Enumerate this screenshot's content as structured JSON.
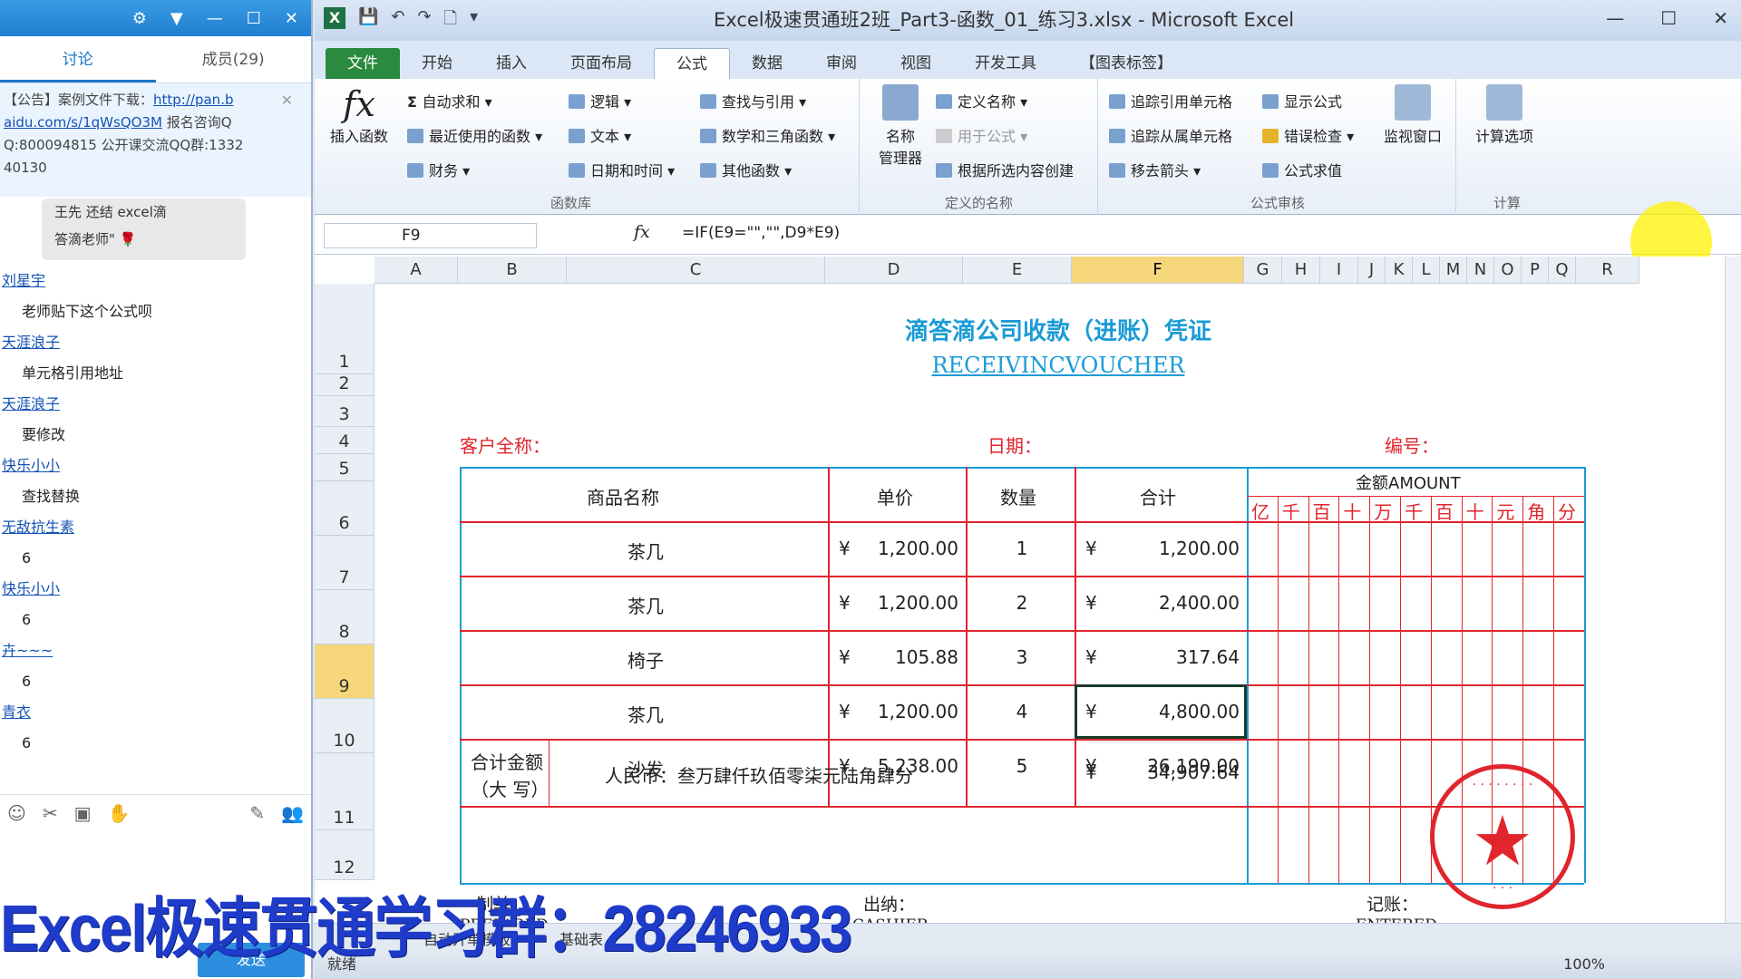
{
  "chat": {
    "tabs": [
      "讨论",
      "成员(29)"
    ],
    "notice_prefix": "【公告】案例文件下载：",
    "notice_link1": "http://pan.b",
    "notice_link2": "aidu.com/s/1qWsQO3M",
    "notice_rest1": " 报名咨询Q",
    "notice_line3": "Q:800094815  公开课交流QQ群:1332",
    "notice_line4": "40130",
    "quote_line1": "王先  还结  excel滴",
    "quote_line2": "答滴老师\"",
    "messages": [
      {
        "user": "刘星宇",
        "text": "老师贴下这个公式呗"
      },
      {
        "user": "天涯浪子",
        "text": "单元格引用地址"
      },
      {
        "user": "天涯浪子",
        "text": "要修改"
      },
      {
        "user": "快乐小小",
        "text": "查找替换"
      },
      {
        "user": "无敌抗生素",
        "text": "6"
      },
      {
        "user": "快乐小小",
        "text": "6"
      },
      {
        "user": "卉~~~",
        "text": "6"
      },
      {
        "user": "青衣",
        "text": "6"
      }
    ],
    "send_label": "发送",
    "watermark": "Excel极速贯通学习群：28246933"
  },
  "excel": {
    "title": "Excel极速贯通班2班_Part3-函数_01_练习3.xlsx - Microsoft Excel",
    "tabs": [
      "文件",
      "开始",
      "插入",
      "页面布局",
      "公式",
      "数据",
      "审阅",
      "视图",
      "开发工具",
      "【图表标签】"
    ],
    "ribbon": {
      "insert_function": "插入函数",
      "autosum": "自动求和",
      "recent": "最近使用的函数",
      "finance": "财务",
      "logic": "逻辑",
      "text": "文本",
      "datetime": "日期和时间",
      "lookup": "查找与引用",
      "math": "数学和三角函数",
      "other": "其他函数",
      "group_lib": "函数库",
      "name_mgr1": "名称",
      "name_mgr2": "管理器",
      "define_name": "定义名称",
      "use_in_formula": "用于公式",
      "create_sel": "根据所选内容创建",
      "group_names": "定义的名称",
      "trace_prec": "追踪引用单元格",
      "trace_dep": "追踪从属单元格",
      "remove_arrows": "移去箭头",
      "show_formulas": "显示公式",
      "error_check": "错误检查",
      "eval_formula": "公式求值",
      "group_audit": "公式审核",
      "watch": "监视窗口",
      "calc_options": "计算选项",
      "group_calc": "计算"
    },
    "name_box": "F9",
    "formula": "=IF(E9=\"\",\"\",D9*E9)",
    "columns": [
      "A",
      "B",
      "C",
      "D",
      "E",
      "F",
      "G",
      "H",
      "I",
      "J",
      "K",
      "L",
      "M",
      "N",
      "O",
      "P",
      "Q",
      "R"
    ],
    "rows": [
      "1",
      "2",
      "3",
      "4",
      "5",
      "6",
      "7",
      "8",
      "9",
      "10",
      "11",
      "12"
    ],
    "voucher": {
      "title": "滴答滴公司收款（进账）凭证",
      "subtitle": "RECEIVINCVOUCHER",
      "customer_label": "客户全称：",
      "date_label": "日期：",
      "number_label": "编号：",
      "h_name": "商品名称",
      "h_price": "单价",
      "h_qty": "数量",
      "h_total": "合计",
      "h_amount": "金额AMOUNT",
      "digits": [
        "亿",
        "千",
        "百",
        "十",
        "万",
        "千",
        "百",
        "十",
        "元",
        "角",
        "分"
      ],
      "currency": "¥",
      "items": [
        {
          "name": "茶几",
          "price": "1,200.00",
          "qty": "1",
          "total": "1,200.00"
        },
        {
          "name": "茶几",
          "price": "1,200.00",
          "qty": "2",
          "total": "2,400.00"
        },
        {
          "name": "椅子",
          "price": "105.88",
          "qty": "3",
          "total": "317.64"
        },
        {
          "name": "茶几",
          "price": "1,200.00",
          "qty": "4",
          "total": "4,800.00"
        },
        {
          "name": "沙发",
          "price": "5,238.00",
          "qty": "5",
          "total": "26,190.00"
        }
      ],
      "sum_label1": "合计金额",
      "sum_label2": "（大  写）",
      "sum_text": "人民币：叁万肆仟玖佰零柒元陆角肆分",
      "sum_total": "34,907.64",
      "prepared": "制单：",
      "prepared_en": "PREPARED",
      "cashier": "出纳：",
      "cashier_en": "CASHIER",
      "entered": "记账：",
      "entered_en": "ENTERED"
    },
    "sheet_tab": "自动开单模板",
    "sheet_tab2": "基础表",
    "status": "就绪",
    "zoom": "100%"
  }
}
